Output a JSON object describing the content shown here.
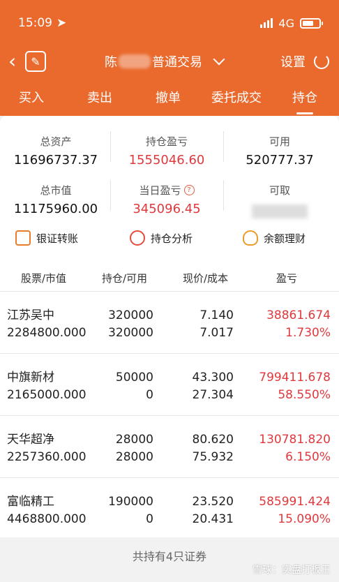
{
  "status": {
    "time": "15:09",
    "network": "4G"
  },
  "nav": {
    "title_prefix": "陈",
    "title_suffix": "普通交易",
    "settings": "设置"
  },
  "tabs": [
    "买入",
    "卖出",
    "撤单",
    "委托成交",
    "持仓"
  ],
  "summary": {
    "total_assets_label": "总资产",
    "total_assets": "11696737.37",
    "position_pl_label": "持仓盈亏",
    "position_pl": "1555046.60",
    "available_label": "可用",
    "available": "520777.37",
    "market_value_label": "总市值",
    "market_value": "11175960.00",
    "daily_pl_label": "当日盈亏",
    "daily_pl": "345096.45",
    "withdrawable_label": "可取"
  },
  "actions": {
    "transfer": "银证转账",
    "analysis": "持仓分析",
    "wealth": "余额理财"
  },
  "table": {
    "headers": [
      "股票/市值",
      "持仓/可用",
      "现价/成本",
      "盈亏"
    ],
    "rows": [
      {
        "name": "江苏吴中",
        "market_value": "2284800.000",
        "position": "320000",
        "available": "320000",
        "price": "7.140",
        "cost": "7.017",
        "pl": "38861.674",
        "pct": "1.730%"
      },
      {
        "name": "中旗新材",
        "market_value": "2165000.000",
        "position": "50000",
        "available": "0",
        "price": "43.300",
        "cost": "27.304",
        "pl": "799411.678",
        "pct": "58.550%"
      },
      {
        "name": "天华超净",
        "market_value": "2257360.000",
        "position": "28000",
        "available": "28000",
        "price": "80.620",
        "cost": "75.932",
        "pl": "130781.820",
        "pct": "6.150%"
      },
      {
        "name": "富临精工",
        "market_value": "4468800.000",
        "position": "190000",
        "available": "0",
        "price": "23.520",
        "cost": "20.431",
        "pl": "585991.424",
        "pct": "15.090%"
      }
    ]
  },
  "footer": "共持有4只证券",
  "watermark": "雪球：实盘打板王",
  "colors": {
    "brand": "#ea6a2e",
    "profit": "#e0383d"
  }
}
